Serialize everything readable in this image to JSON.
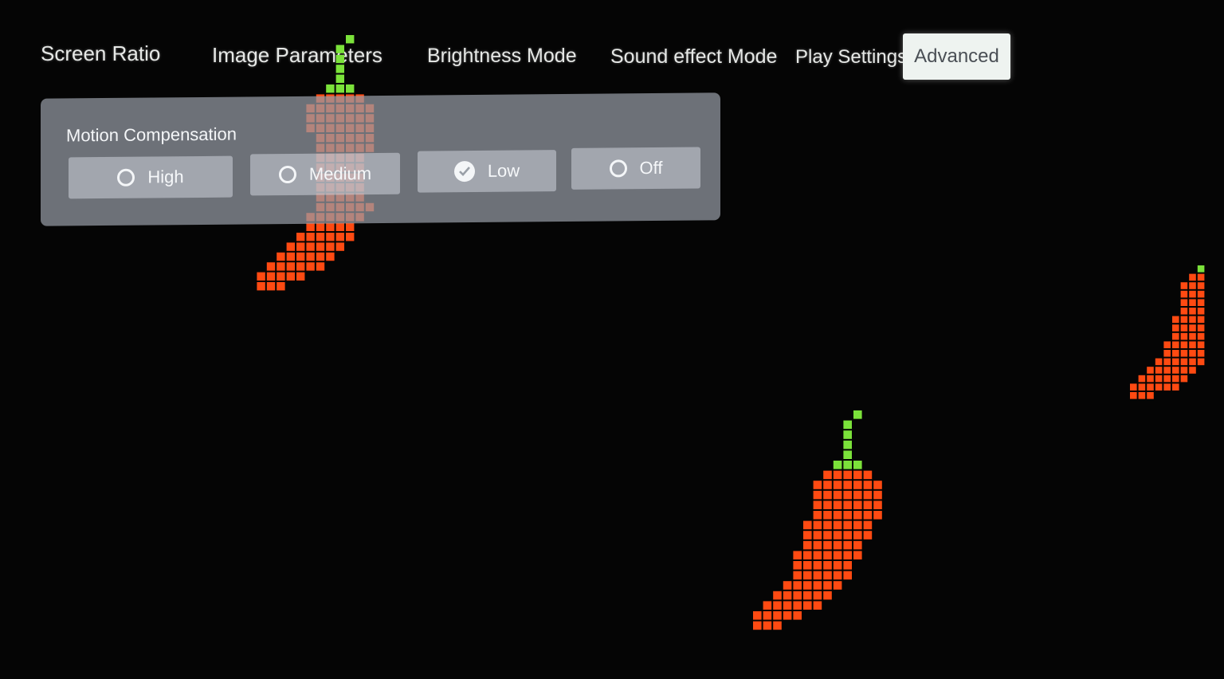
{
  "tabs": [
    {
      "label": "Screen Ratio",
      "active": false
    },
    {
      "label": "Image Parameters",
      "active": false
    },
    {
      "label": "Brightness Mode",
      "active": false
    },
    {
      "label": "Sound effect Mode",
      "active": false
    },
    {
      "label": "Play Settings",
      "active": false
    },
    {
      "label": "Advanced",
      "active": true
    }
  ],
  "panel": {
    "title": "Motion Compensation",
    "options": [
      {
        "label": "High",
        "selected": false,
        "icon": "radio-empty-icon"
      },
      {
        "label": "Medium",
        "selected": false,
        "icon": "radio-empty-icon"
      },
      {
        "label": "Low",
        "selected": true,
        "icon": "check-circle-icon"
      },
      {
        "label": "Off",
        "selected": false,
        "icon": "radio-empty-icon"
      }
    ]
  },
  "colors": {
    "pepper_body": "#ff4a12",
    "pepper_stem": "#7be23a",
    "active_tab_bg": "#eef3f0"
  }
}
